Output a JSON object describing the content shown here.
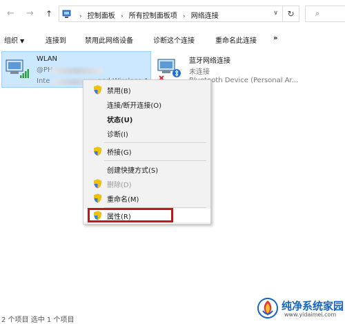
{
  "nav": {
    "back_glyph": "←",
    "forward_glyph": "→",
    "up_glyph": "↑"
  },
  "address": {
    "crumbs": [
      "控制面板",
      "所有控制面板项",
      "网络连接"
    ],
    "dropdown_glyph": "∨",
    "refresh_glyph": "↻",
    "search_glyph": "⌕"
  },
  "toolbar": {
    "organize": "组织",
    "organize_caret": "▼",
    "connect_to": "连接到",
    "disable_device": "禁用此网络设备",
    "diagnose": "诊断这个连接",
    "rename": "重命名此连接",
    "more": "»"
  },
  "connections": [
    {
      "name": "WLAN",
      "detail1": "@PH",
      "detail2a": "Inte",
      "detail2b": "ged Wireless-A",
      "icon": "wifi-adapter-icon"
    },
    {
      "name": "蓝牙网络连接",
      "status": "未连接",
      "detail": "Bluetooth Device (Personal Ar...",
      "icon": "bluetooth-adapter-icon"
    }
  ],
  "context_menu": {
    "disable": "禁用(B)",
    "connect_disconnect": "连接/断开连接(O)",
    "status": "状态(U)",
    "diagnose": "诊断(I)",
    "bridge": "桥接(G)",
    "create_shortcut": "创建快捷方式(S)",
    "delete": "删除(D)",
    "rename": "重命名(M)",
    "properties": "属性(R)"
  },
  "statusbar": {
    "text": "2 个项目    选中 1 个项目"
  },
  "watermark": {
    "title": "纯净系统家园",
    "url": "www.yidaimei.com"
  },
  "colors": {
    "selection_bg": "#cce8ff",
    "highlight_border": "#c0161e",
    "brand_blue": "#1565c0"
  }
}
